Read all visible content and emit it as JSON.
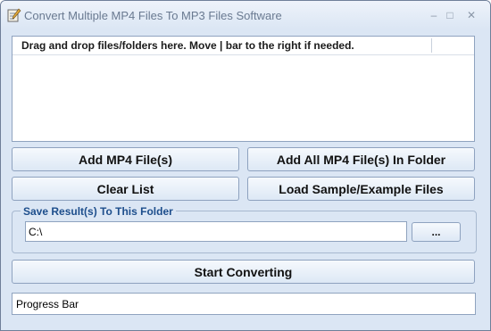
{
  "window": {
    "title": "Convert Multiple MP4 Files To MP3 Files Software",
    "minimize_glyph": "–",
    "maximize_glyph": "□",
    "close_glyph": "✕"
  },
  "file_list": {
    "header": "Drag and drop files/folders here. Move | bar to the right if needed."
  },
  "buttons": {
    "add_files": "Add MP4 File(s)",
    "add_folder": "Add All MP4 File(s) In Folder",
    "clear_list": "Clear List",
    "load_sample": "Load Sample/Example Files",
    "browse": "...",
    "start": "Start Converting"
  },
  "save_folder": {
    "label": "Save Result(s) To This Folder",
    "value": "C:\\"
  },
  "progress": {
    "label": "Progress Bar"
  },
  "colors": {
    "window_bg": "#dbe6f4",
    "group_label": "#1d4e8c",
    "title_text": "#6a7a91"
  },
  "icons": {
    "app": "notepad-pencil-icon"
  }
}
